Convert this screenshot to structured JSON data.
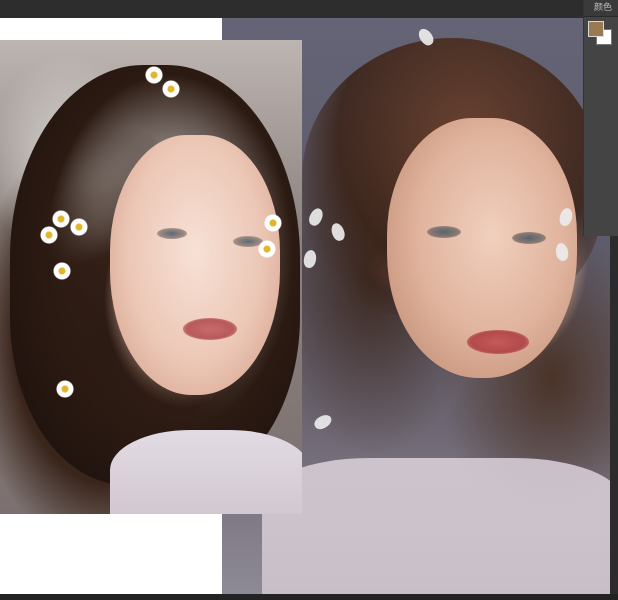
{
  "panel": {
    "header_label": "颜色",
    "foreground_color": "#9a7a52",
    "background_color": "#ffffff"
  },
  "canvas": {
    "left_layer": "reference-photo",
    "right_layer": "painting-in-progress"
  }
}
